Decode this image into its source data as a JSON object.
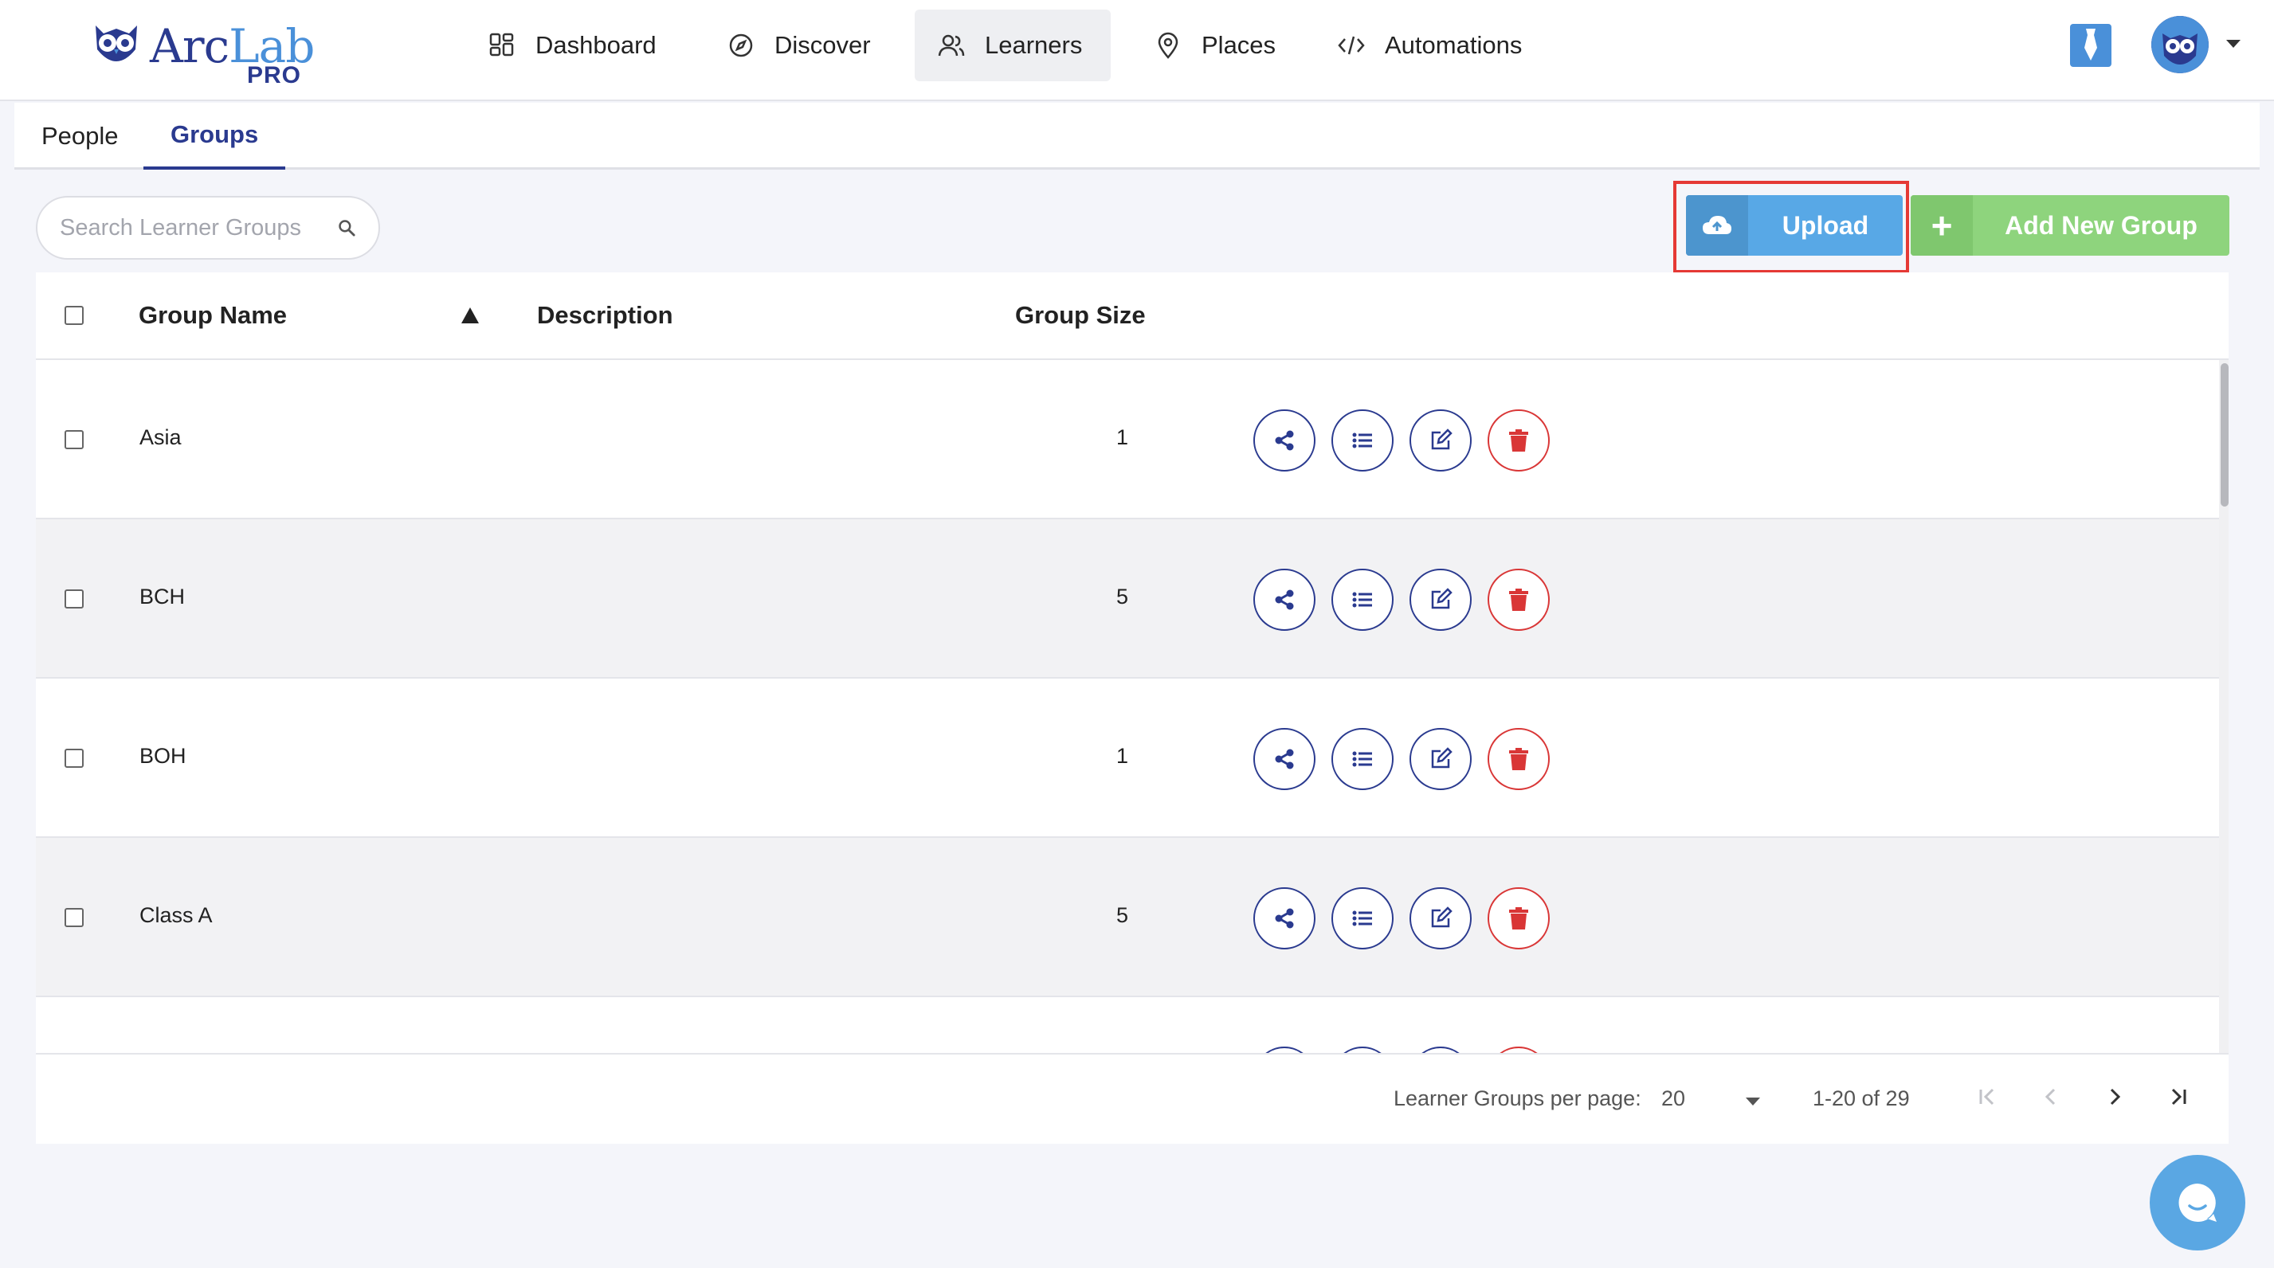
{
  "brand": {
    "name_part1": "Arc",
    "name_part2": "Lab",
    "tier": "PRO",
    "primary_color": "#2a3a8f",
    "accent_color": "#4a90d9"
  },
  "nav": {
    "items": [
      {
        "label": "Dashboard",
        "icon": "dashboard-icon"
      },
      {
        "label": "Discover",
        "icon": "compass-icon"
      },
      {
        "label": "Learners",
        "icon": "users-icon",
        "active": true
      },
      {
        "label": "Places",
        "icon": "map-pin-icon"
      },
      {
        "label": "Automations",
        "icon": "code-icon"
      }
    ]
  },
  "tabs": [
    {
      "label": "People",
      "active": false
    },
    {
      "label": "Groups",
      "active": true
    }
  ],
  "search": {
    "placeholder": "Search Learner Groups",
    "value": ""
  },
  "actions": {
    "upload_label": "Upload",
    "add_label": "Add New Group",
    "upload_color": "#58a8e6",
    "add_color": "#8ed47d",
    "highlight_color": "#e53935"
  },
  "table": {
    "columns": {
      "name": "Group Name",
      "description": "Description",
      "size": "Group Size"
    },
    "sort": {
      "column": "Group Name",
      "direction": "ascending"
    },
    "rows": [
      {
        "name": "Asia",
        "description": "",
        "size": "1"
      },
      {
        "name": "BCH",
        "description": "",
        "size": "5"
      },
      {
        "name": "BOH",
        "description": "",
        "size": "1"
      },
      {
        "name": "Class A",
        "description": "",
        "size": "5"
      }
    ],
    "row_actions": [
      "share-icon",
      "list-icon",
      "edit-icon",
      "trash-icon"
    ]
  },
  "pagination": {
    "per_page_label": "Learner Groups per page:",
    "per_page_value": "20",
    "range": "1-20 of 29"
  }
}
